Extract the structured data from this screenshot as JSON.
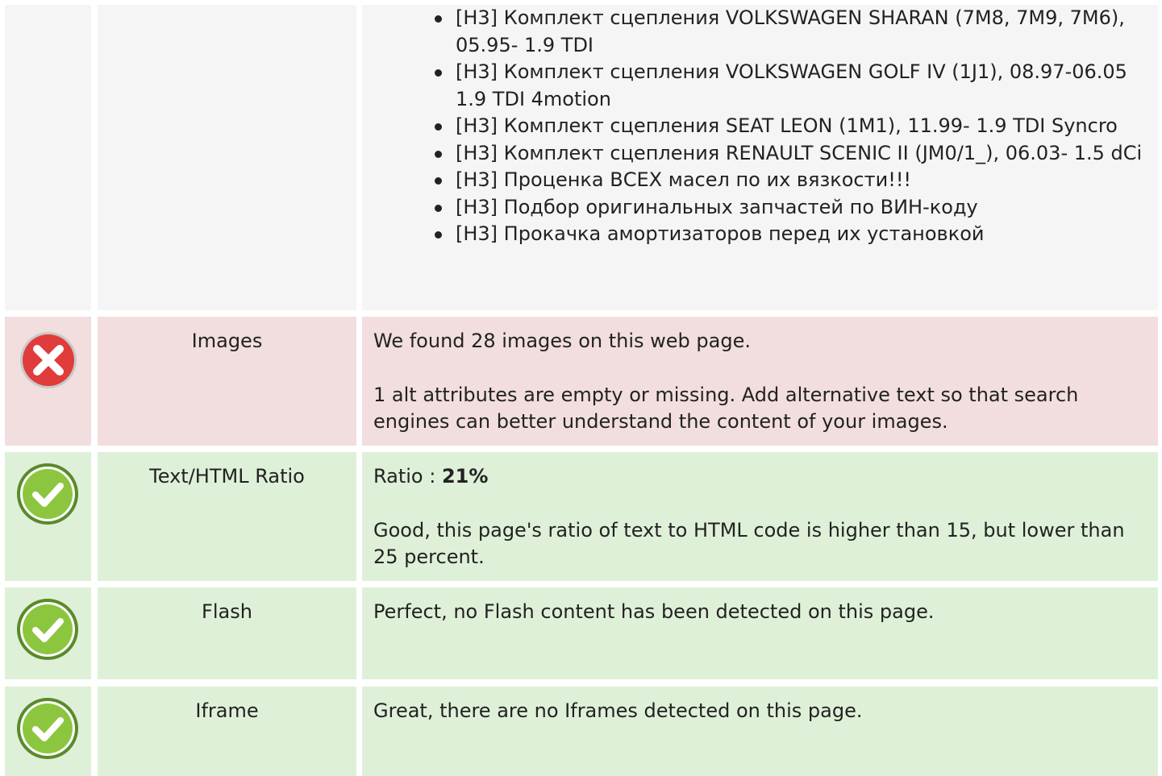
{
  "headings_row": {
    "items": [
      "[H3] Комплект сцепления VOLKSWAGEN SHARAN (7M8, 7M9, 7M6), 05.95- 1.9 TDI",
      "[H3] Комплект сцепления VOLKSWAGEN GOLF IV (1J1), 08.97-06.05 1.9 TDI 4motion",
      "[H3] Комплект сцепления SEAT LEON (1M1), 11.99- 1.9 TDI Syncro",
      "[H3] Комплект сцепления RENAULT SCENIC II (JM0/1_), 06.03- 1.5 dCi",
      "[H3] Проценка ВСЕХ масел по их вязкости!!!",
      "[H3] Подбор оригинальных запчастей по ВИН-коду",
      "[H3] Прокачка амортизаторов перед их установкой"
    ]
  },
  "rows": {
    "images": {
      "status": "error",
      "status_icon": "error-icon",
      "label": "Images",
      "line1": "We found 28 images on this web page.",
      "line2": "1 alt attributes are empty or missing. Add alternative text so that search engines can better understand the content of your images."
    },
    "ratio": {
      "status": "ok",
      "status_icon": "check-icon",
      "label": "Text/HTML Ratio",
      "ratio_prefix": "Ratio : ",
      "ratio_value": "21%",
      "line2": "Good, this page's ratio of text to HTML code is higher than 15, but lower than 25 percent."
    },
    "flash": {
      "status": "ok",
      "status_icon": "check-icon",
      "label": "Flash",
      "line1": "Perfect, no Flash content has been detected on this page."
    },
    "iframe": {
      "status": "ok",
      "status_icon": "check-icon",
      "label": "Iframe",
      "line1": "Great, there are no Iframes detected on this page."
    }
  },
  "colors": {
    "neutral_row": "#f5f5f5",
    "error_row": "#f2dede",
    "ok_row": "#dff0d8",
    "error_icon": "#e03c3c",
    "ok_icon": "#8cc63f"
  }
}
